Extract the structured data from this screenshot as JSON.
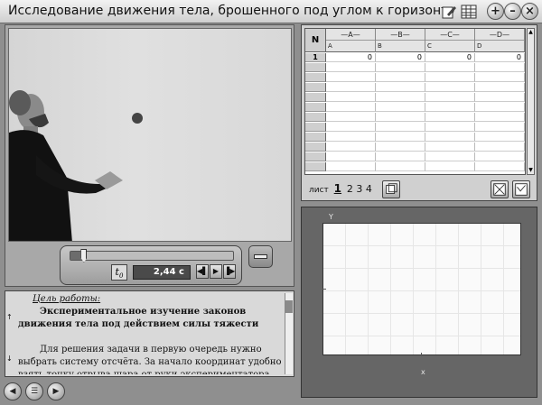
{
  "window": {
    "title": "Исследование движения тела, брошенного под углом к горизонту",
    "buttons": {
      "add": "+",
      "minimize": "–",
      "close": "×"
    }
  },
  "video": {
    "slider_position": 0.08,
    "t0_label": "t",
    "t0_sub": "0",
    "time_display": "2,44 с"
  },
  "text": {
    "goal_title": "Цель работы:",
    "goal_text": "Экспериментальное изучение законов движения тела под действием силы тяжести",
    "body": "Для решения задачи в первую очередь нужно выбрать систему отсчёта. За начало координат удобно взять точку отрыва шара от руки экспериментатора, ось x направить"
  },
  "sheet": {
    "row_header": "N",
    "columns": [
      {
        "caption": "—A—",
        "sub": "A"
      },
      {
        "caption": "—B—",
        "sub": "B"
      },
      {
        "caption": "—C—",
        "sub": "C"
      },
      {
        "caption": "—D—",
        "sub": "D"
      }
    ],
    "rows": [
      {
        "n": "1",
        "cells": [
          "0",
          "0",
          "0",
          "0"
        ]
      }
    ],
    "tabs_label": "лист",
    "tab_active": "1",
    "tabs_rest": "2 3 4"
  },
  "graph": {
    "y_label": "Y",
    "x_label": "x"
  },
  "icons": {
    "edit": "edit-icon",
    "table": "table-icon",
    "back": "back-arrow-icon",
    "menu": "menu-icon",
    "forward": "forward-arrow-icon"
  }
}
